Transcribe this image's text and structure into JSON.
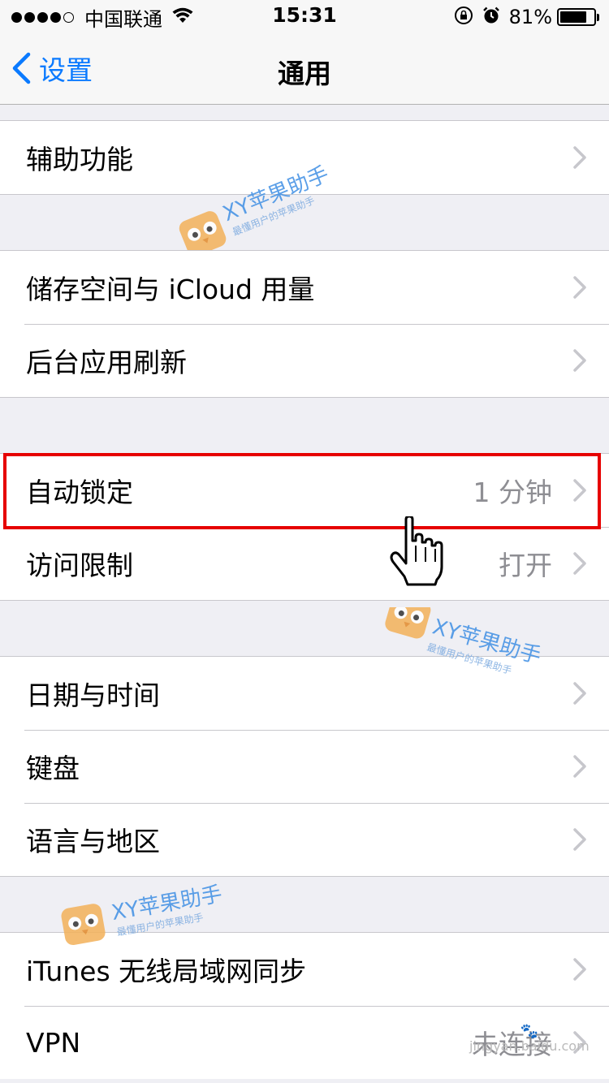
{
  "status_bar": {
    "carrier": "中国联通",
    "time": "15:31",
    "battery_percent": "81%",
    "battery_level": 0.81,
    "signal_bars": 4,
    "icons": [
      "wifi-icon",
      "rotation-lock-icon",
      "alarm-icon",
      "battery-icon"
    ]
  },
  "nav": {
    "back_label": "设置",
    "title": "通用"
  },
  "groups": [
    [
      {
        "label": "辅助功能",
        "value": ""
      }
    ],
    [
      {
        "label": "储存空间与 iCloud 用量",
        "value": ""
      },
      {
        "label": "后台应用刷新",
        "value": ""
      }
    ],
    [
      {
        "label": "自动锁定",
        "value": "1 分钟"
      },
      {
        "label": "访问限制",
        "value": "打开"
      }
    ],
    [
      {
        "label": "日期与时间",
        "value": ""
      },
      {
        "label": "键盘",
        "value": ""
      },
      {
        "label": "语言与地区",
        "value": ""
      }
    ],
    [
      {
        "label": "iTunes 无线局域网同步",
        "value": ""
      },
      {
        "label": "VPN",
        "value": "未连接"
      }
    ]
  ],
  "watermark": {
    "brand": "XY苹果助手",
    "slogan": "最懂用户的苹果助手",
    "site": "jingyan.baidu.com"
  },
  "colors": {
    "accent": "#0a7aff",
    "highlight": "#e60000",
    "background": "#efeff4"
  }
}
